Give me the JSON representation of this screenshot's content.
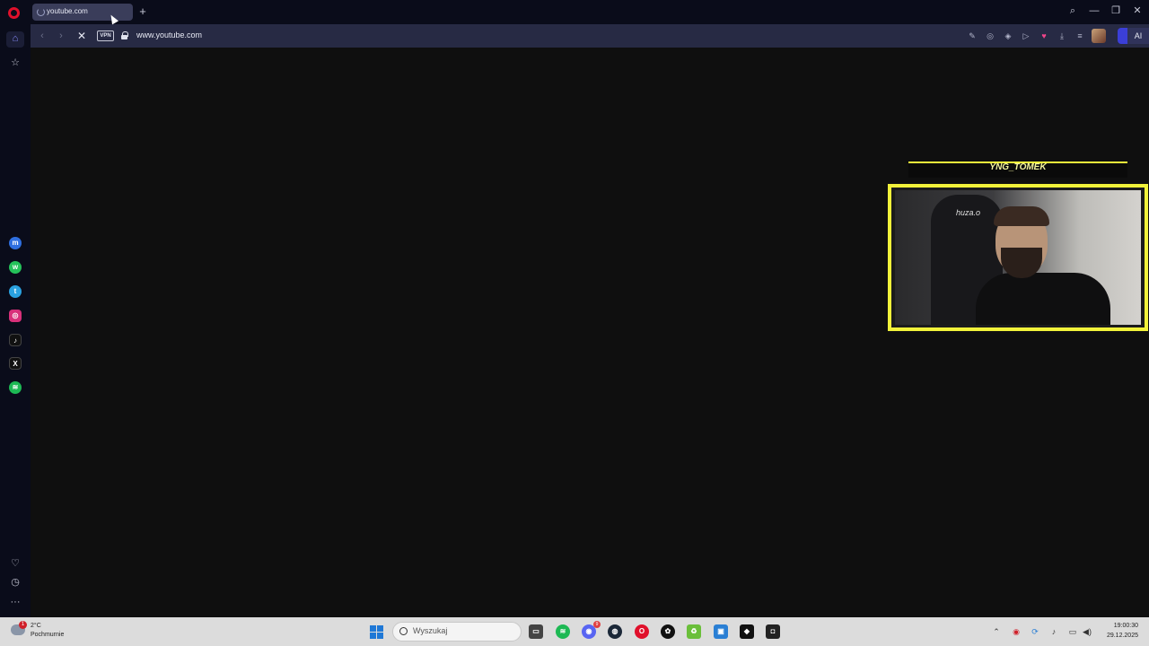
{
  "browser": {
    "tab": {
      "title": "youtube.com"
    },
    "newtab_symbol": "+",
    "window_controls": {
      "search": "⌕",
      "minimize": "—",
      "restore": "❐",
      "close": "✕"
    }
  },
  "address_bar": {
    "back": "‹",
    "forward": "›",
    "stop": "✕",
    "vpn_label": "VPN",
    "url": "www.youtube.com",
    "toolbar_icons": {
      "edit": "✎",
      "camera": "◎",
      "shield": "◈",
      "play": "▷",
      "heart": "♥",
      "download": "⤓",
      "menu": "≡"
    },
    "ai_label": "AI"
  },
  "sidebar": {
    "home": "⌂",
    "star": "☆",
    "messenger": "m",
    "whatsapp": "w",
    "telegram": "t",
    "instagram": "◎",
    "tiktok": "♪",
    "x": "X",
    "spotify": "≋",
    "heart": "♡",
    "history": "◷",
    "more": "···"
  },
  "webcam": {
    "name": "YNG_TOMEK",
    "chair_brand": "huza.o"
  },
  "taskbar": {
    "weather": {
      "badge": "1",
      "temperature": "2°C",
      "description": "Pochmurnie"
    },
    "search_placeholder": "Wyszukaj",
    "apps": {
      "files": "▭",
      "spotify": "≋",
      "discord": "◉",
      "discord_badge": "9",
      "steam": "◍",
      "opera": "O",
      "chatgpt": "✿",
      "recycle": "♻",
      "photos": "▣",
      "android": "◆",
      "obs": "◘"
    },
    "tray": {
      "chevron": "⌃",
      "adobe": "◉",
      "sync": "⟳",
      "mic": "♪",
      "monitor": "▭",
      "volume": "◀)"
    },
    "time": "19:00:30",
    "date": "29.12.2025"
  },
  "colors": {
    "accent": "#f1f23a",
    "opera_red": "#e0102b",
    "ai_blue": "#3b3fd8"
  }
}
